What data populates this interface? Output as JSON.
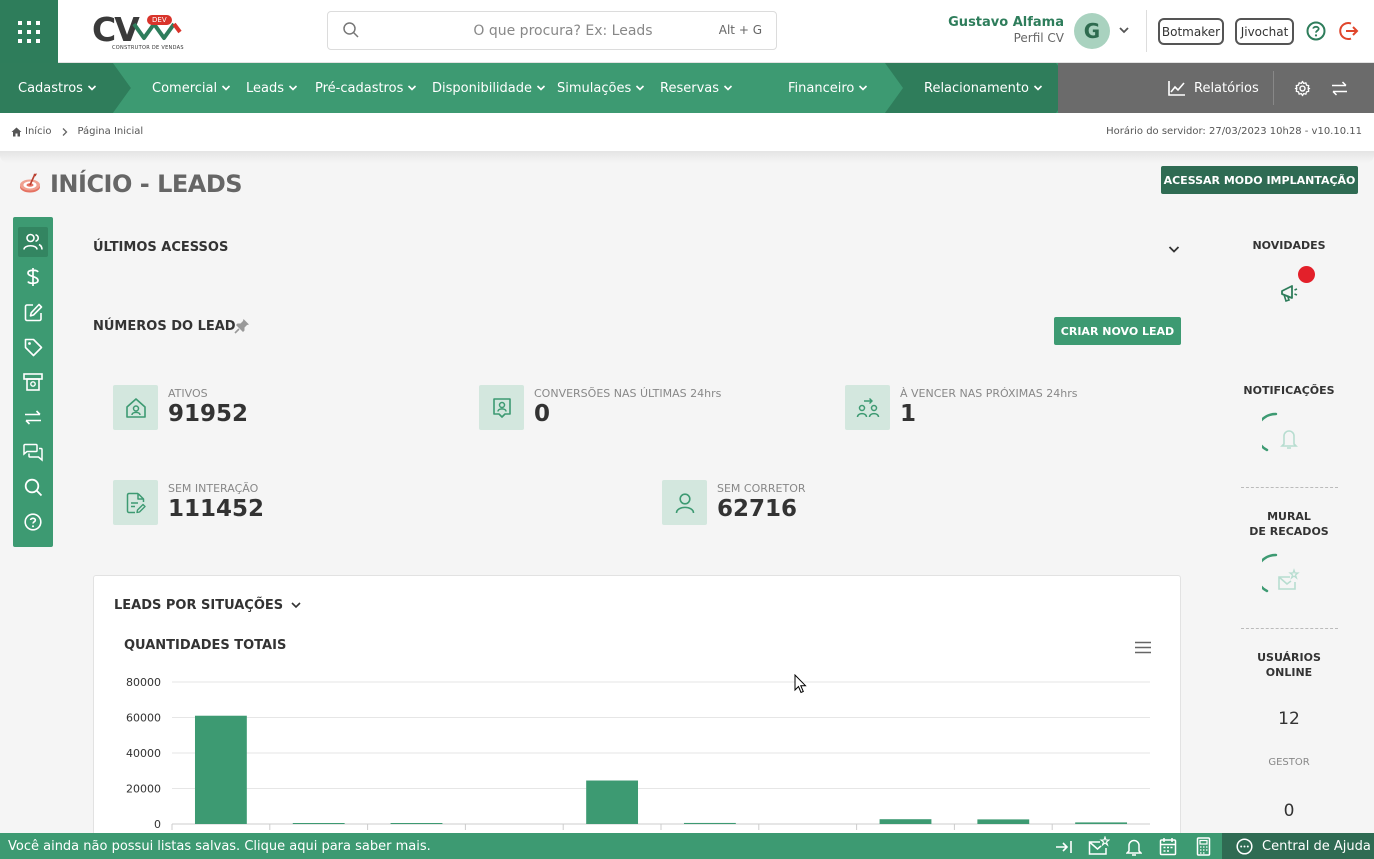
{
  "header": {
    "logo_text": "CV",
    "logo_badge": "DEV",
    "logo_subtitle": "CONSTRUTOR DE VENDAS",
    "search_placeholder": "O que procura? Ex: Leads",
    "search_shortcut": "Alt + G",
    "user_name": "Gustavo Alfama",
    "user_role": "Perfil CV",
    "avatar_letter": "G",
    "botmaker_label": "Botmaker",
    "jivochat_label": "Jivochat"
  },
  "nav": {
    "items": [
      {
        "label": "Cadastros"
      },
      {
        "label": "Comercial"
      },
      {
        "label": "Leads"
      },
      {
        "label": "Pré-cadastros"
      },
      {
        "label": "Disponibilidade"
      },
      {
        "label": "Simulações"
      },
      {
        "label": "Reservas"
      },
      {
        "label": "Financeiro"
      },
      {
        "label": "Relacionamento"
      }
    ],
    "reports_label": "Relatórios"
  },
  "breadcrumb": {
    "home": "Início",
    "current": "Página Inicial",
    "server_time": "Horário do servidor: 27/03/2023 10h28 - v10.10.11"
  },
  "page": {
    "title": "INÍCIO - LEADS",
    "implant_button": "ACESSAR MODO IMPLANTAÇÃO"
  },
  "main": {
    "last_access_title": "ÚLTIMOS ACESSOS",
    "lead_numbers_title": "NÚMEROS DO LEAD",
    "new_lead_button": "CRIAR NOVO LEAD",
    "stats": [
      {
        "label": "ATIVOS",
        "value": "91952"
      },
      {
        "label": "CONVERSÕES NAS ÚLTIMAS 24hrs",
        "value": "0"
      },
      {
        "label": "À VENCER NAS PRÓXIMAS 24hrs",
        "value": "1"
      },
      {
        "label": "SEM INTERAÇÃO",
        "value": "111452"
      },
      {
        "label": "SEM CORRETOR",
        "value": "62716"
      }
    ],
    "chart_section_title": "LEADS POR SITUAÇÕES",
    "chart_title": "QUANTIDADES TOTAIS"
  },
  "chart_data": {
    "type": "bar",
    "title": "QUANTIDADES TOTAIS",
    "categories": [
      "",
      "",
      "",
      "",
      "",
      "",
      "",
      "",
      "",
      ""
    ],
    "values": [
      61000,
      500,
      300,
      0,
      24500,
      600,
      0,
      2700,
      2600,
      900
    ],
    "ylim": [
      0,
      80000
    ],
    "yticks": [
      "80000",
      "60000",
      "40000",
      "20000",
      "0"
    ],
    "color": "#3d9a72",
    "grid": true
  },
  "right_panel": {
    "news_title": "NOVIDADES",
    "notifications_title": "NOTIFICAÇÕES",
    "mural_title_1": "MURAL",
    "mural_title_2": "DE RECADOS",
    "online_title_1": "USUÁRIOS",
    "online_title_2": "ONLINE",
    "online_count": "12",
    "gestor_label": "GESTOR",
    "gestor_count": "0"
  },
  "footer": {
    "message": "Você ainda não possui listas salvas. Clique aqui para saber mais.",
    "help_center": "Central de Ajuda"
  },
  "colors": {
    "primary": "#3d9a72",
    "primary_dark": "#2f6b53",
    "gray_nav": "#6b6b6b",
    "alert": "#e3202a"
  }
}
